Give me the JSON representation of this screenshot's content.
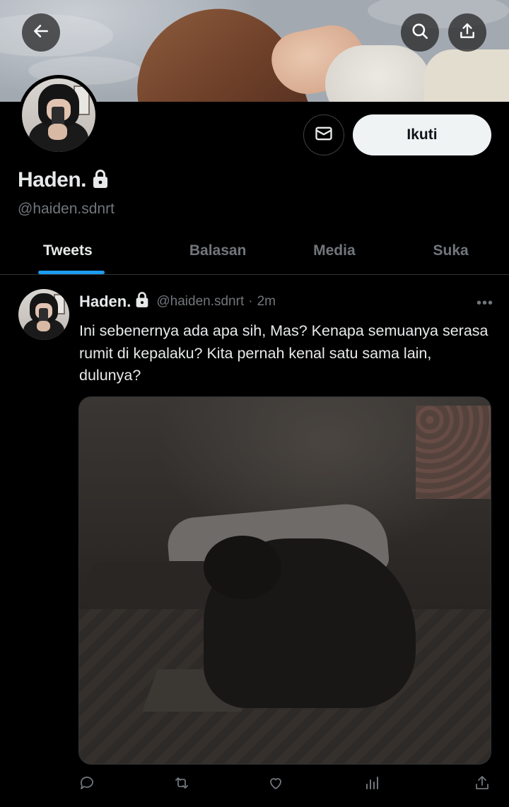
{
  "header": {
    "back_icon": "arrow-left-icon",
    "search_icon": "search-icon",
    "share_icon": "share-upload-icon"
  },
  "profile": {
    "display_name": "Haden.",
    "handle": "@haiden.sdnrt",
    "protected_icon": "lock-icon",
    "message_icon": "envelope-icon",
    "follow_label": "Ikuti"
  },
  "tabs": [
    {
      "label": "Tweets",
      "active": true
    },
    {
      "label": "Balasan",
      "active": false
    },
    {
      "label": "Media",
      "active": false
    },
    {
      "label": "Suka",
      "active": false
    }
  ],
  "tweet": {
    "author_name": "Haden.",
    "author_handle": "@haiden.sdnrt",
    "separator": "·",
    "time": "2m",
    "more_label": "•••",
    "text": "Ini sebenernya ada apa sih, Mas? Kenapa semuanya serasa rumit di kepalaku? Kita pernah kenal satu sama lain, dulunya?",
    "actions": [
      "reply-icon",
      "retweet-icon",
      "like-icon",
      "views-icon",
      "share-icon"
    ]
  },
  "colors": {
    "accent": "#1d9bf0",
    "text_primary": "#e7e9ea",
    "text_secondary": "#71767b",
    "background": "#000000",
    "border": "#2f3336",
    "follow_button_bg": "#eff3f4"
  }
}
